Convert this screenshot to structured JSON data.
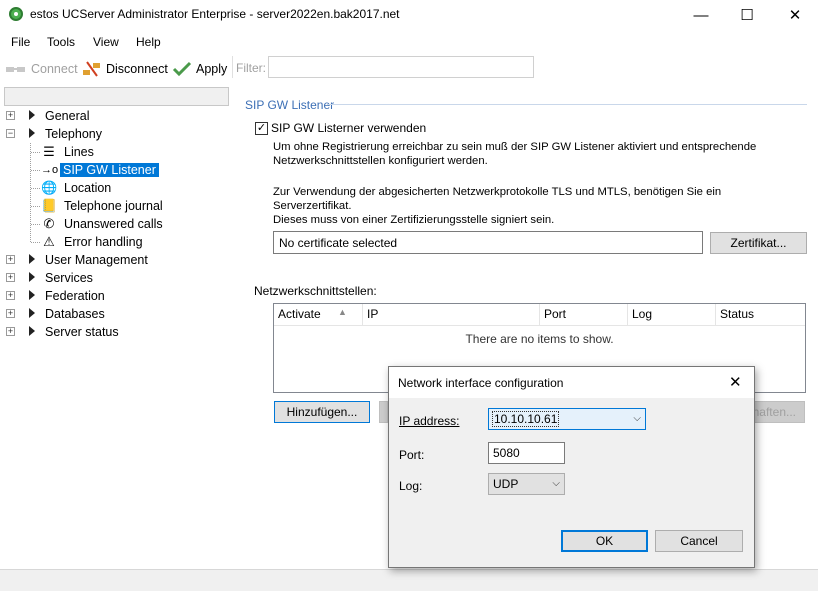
{
  "window": {
    "title": "estos UCServer Administrator Enterprise - server2022en.bak2017.net",
    "minimize": "—",
    "maximize": "☐",
    "close": "✕"
  },
  "menu": {
    "file": "File",
    "tools": "Tools",
    "view": "View",
    "help": "Help"
  },
  "toolbar": {
    "connect": "Connect",
    "disconnect": "Disconnect",
    "apply": "Apply",
    "filter_label": "Filter:",
    "filter_value": ""
  },
  "tree": {
    "general": "General",
    "telephony": "Telephony",
    "lines": "Lines",
    "sip_gw_listener": "SIP GW Listener",
    "location": "Location",
    "telephone_journal": "Telephone journal",
    "unanswered_calls": "Unanswered calls",
    "error_handling": "Error handling",
    "user_management": "User Management",
    "services": "Services",
    "federation": "Federation",
    "databases": "Databases",
    "server_status": "Server status"
  },
  "panel": {
    "section_title": "SIP GW Listener",
    "use_listener_label": "SIP GW Listerner verwenden",
    "use_listener_checked": true,
    "para1_line1": "Um ohne Registrierung erreichbar zu sein muß der SIP GW Listener aktiviert und entsprechende",
    "para1_line2": "Netzwerkschnittstellen konfiguriert werden.",
    "para2_line1": "Zur Verwendung der abgesicherten Netzwerkprotokolle TLS und MTLS, benötigen Sie ein Serverzertifikat.",
    "para2_line2": "Dieses muss von einer Zertifizierungsstelle signiert sein.",
    "certificate_value": "No certificate selected",
    "certificate_button": "Zertifikat...",
    "interfaces_label": "Netzwerkschnittstellen:",
    "columns": [
      "Activate",
      "IP",
      "Port",
      "Log",
      "Status"
    ],
    "empty_message": "There are no items to show.",
    "add_button": "Hinzufügen...",
    "properties_button": "haften..."
  },
  "dialog": {
    "title": "Network interface configuration",
    "close": "✕",
    "ip_label": "IP address:",
    "ip_value": "10.10.10.61",
    "port_label": "Port:",
    "port_value": "5080",
    "log_label": "Log:",
    "log_value": "UDP",
    "ok": "OK",
    "cancel": "Cancel"
  }
}
